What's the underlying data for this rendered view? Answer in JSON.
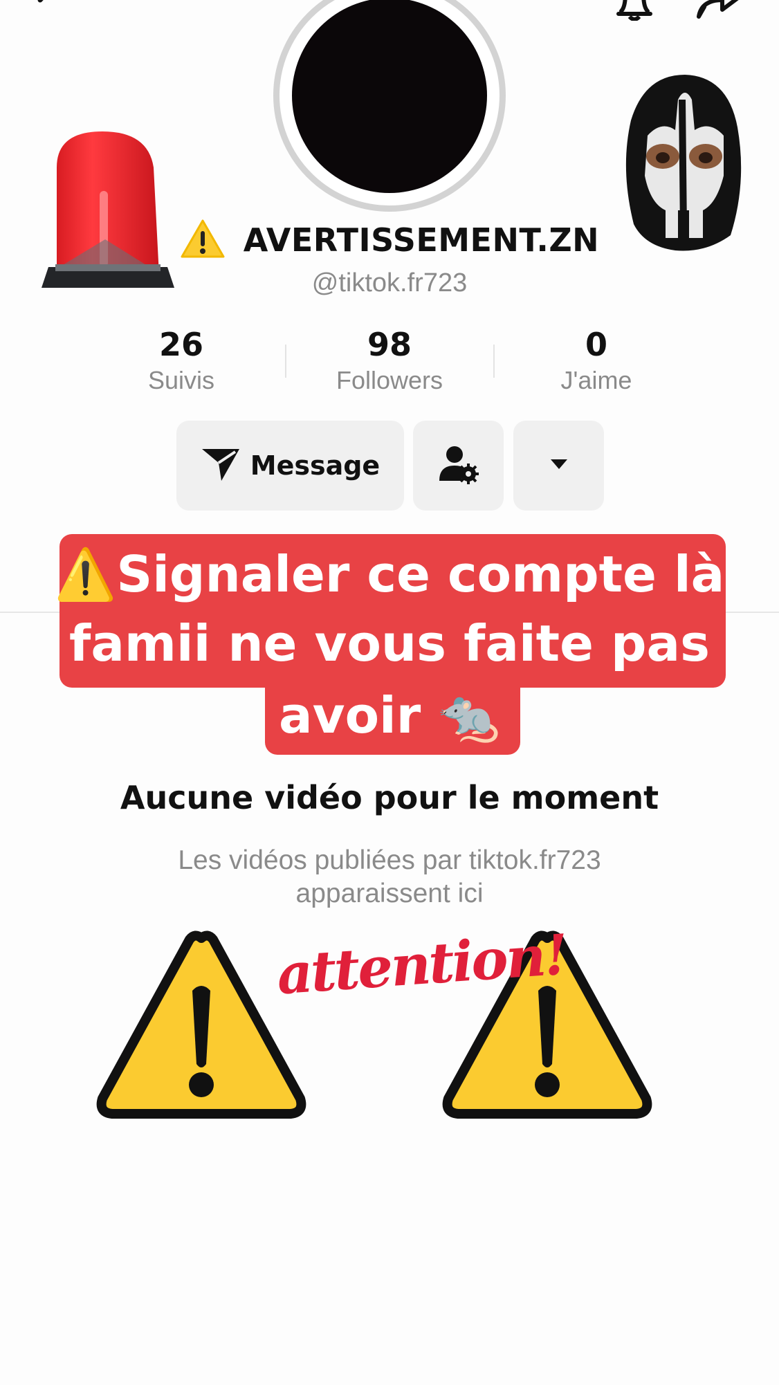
{
  "profile": {
    "display_name": "AVERTISSEMENT.ZN",
    "handle": "@tiktok.fr723"
  },
  "stats": [
    {
      "value": "26",
      "label": "Suivis"
    },
    {
      "value": "98",
      "label": "Followers"
    },
    {
      "value": "0",
      "label": "J'aime"
    }
  ],
  "actions": {
    "message_label": "Message"
  },
  "banner": {
    "line1": "⚠️Signaler ce compte là",
    "line2": "famii ne vous faite pas",
    "line3": "avoir 🐀"
  },
  "empty_state": {
    "title": "Aucune vidéo pour le moment",
    "subtitle_line1": "Les vidéos publiées par tiktok.fr723",
    "subtitle_line2": "apparaissent ici"
  },
  "stickers": {
    "attention_text": "attention!"
  },
  "colors": {
    "banner_red": "#e84245",
    "warning_yellow": "#fbcb30",
    "attention_red": "#e0203a"
  },
  "icons": [
    "back-icon",
    "bell-icon",
    "share-icon",
    "send-icon",
    "user-settings-icon",
    "caret-down-icon",
    "warning-icon"
  ]
}
